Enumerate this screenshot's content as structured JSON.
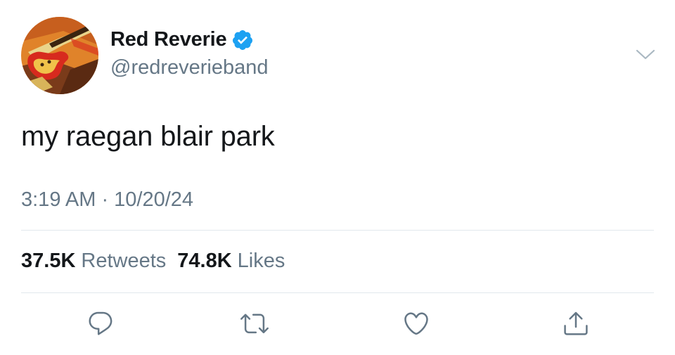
{
  "tweet": {
    "author": {
      "display_name": "Red Reverie",
      "handle": "@redreverieband",
      "verified": true,
      "avatar_icon": "guitar-illustration-avatar"
    },
    "text": "my raegan blair park",
    "timestamp": "3:19 AM · 10/20/24",
    "stats": {
      "retweets_count": "37.5K",
      "retweets_label": "Retweets",
      "likes_count": "74.8K",
      "likes_label": "Likes"
    }
  },
  "actions": [
    {
      "name": "reply",
      "icon": "speech-bubble-icon"
    },
    {
      "name": "retweet",
      "icon": "retweet-arrows-icon"
    },
    {
      "name": "like",
      "icon": "heart-icon"
    },
    {
      "name": "share",
      "icon": "share-upload-icon"
    }
  ],
  "menu": {
    "icon": "chevron-down-icon"
  },
  "colors": {
    "text_primary": "#14171a",
    "text_secondary": "#657786",
    "verified_blue": "#1da1f2",
    "divider": "#e1e8ed",
    "background": "#ffffff"
  }
}
